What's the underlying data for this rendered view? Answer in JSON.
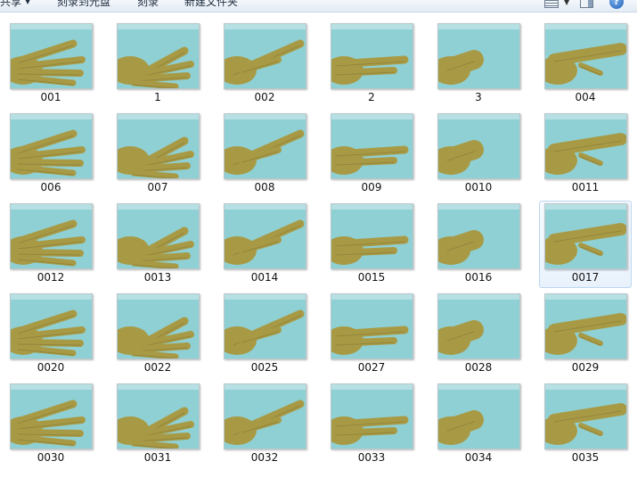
{
  "window": {
    "toolbar": {
      "share_label": "共享",
      "burn_label": "刻录到光盘",
      "record_label": "刻录",
      "new_folder_label": "新建文件夹",
      "help_glyph": "?"
    }
  },
  "files": [
    {
      "name": "001"
    },
    {
      "name": "1"
    },
    {
      "name": "002"
    },
    {
      "name": "2"
    },
    {
      "name": "3"
    },
    {
      "name": "004"
    },
    {
      "name": "006"
    },
    {
      "name": "007"
    },
    {
      "name": "008"
    },
    {
      "name": "009"
    },
    {
      "name": "0010"
    },
    {
      "name": "0011"
    },
    {
      "name": "0012"
    },
    {
      "name": "0013"
    },
    {
      "name": "0014"
    },
    {
      "name": "0015"
    },
    {
      "name": "0016"
    },
    {
      "name": "0017",
      "selected": true
    },
    {
      "name": "0020"
    },
    {
      "name": "0022"
    },
    {
      "name": "0025"
    },
    {
      "name": "0027"
    },
    {
      "name": "0028"
    },
    {
      "name": "0029"
    },
    {
      "name": "0030"
    },
    {
      "name": "0031"
    },
    {
      "name": "0032"
    },
    {
      "name": "0033"
    },
    {
      "name": "0034"
    },
    {
      "name": "0035"
    }
  ],
  "colors": {
    "thumb_background": "#8fd0d4",
    "hand_skin": "#a89a45",
    "selection": "#e9f2fc"
  }
}
